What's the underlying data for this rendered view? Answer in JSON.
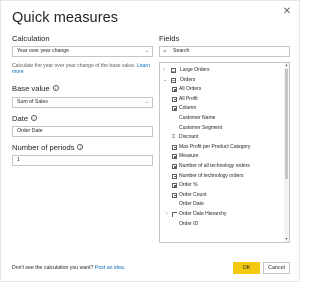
{
  "dialog": {
    "title": "Quick measures",
    "close_glyph": "✕"
  },
  "calculation": {
    "label": "Calculation",
    "selected": "Year over year change",
    "description_prefix": "Calculate the year over year change of the base value.",
    "learn_more": "Learn more"
  },
  "base_value": {
    "label": "Base value",
    "value": "Sum of Sales"
  },
  "date": {
    "label": "Date",
    "value": "Order Date"
  },
  "periods": {
    "label": "Number of periods",
    "value": "1"
  },
  "fields": {
    "label": "Fields",
    "search_placeholder": "Search",
    "items": [
      {
        "label": "Large Orders",
        "icon": "table-icon",
        "chevron": "›",
        "indent": 0
      },
      {
        "label": "Orders",
        "icon": "table-icon",
        "chevron": "⌄",
        "indent": 0
      },
      {
        "label": "All Orders",
        "icon": "calc-icon",
        "chevron": "",
        "indent": 1
      },
      {
        "label": "All Profit",
        "icon": "calc-icon",
        "chevron": "",
        "indent": 1
      },
      {
        "label": "Column",
        "icon": "calc-icon",
        "chevron": "",
        "indent": 1
      },
      {
        "label": "Customer Name",
        "icon": "",
        "chevron": "",
        "indent": 1
      },
      {
        "label": "Customer Segment",
        "icon": "",
        "chevron": "",
        "indent": 1
      },
      {
        "label": "Discount",
        "icon": "sigma-icon",
        "chevron": "",
        "indent": 1
      },
      {
        "label": "Max Profit per Product Category",
        "icon": "calc-icon",
        "chevron": "",
        "indent": 1
      },
      {
        "label": "Measure",
        "icon": "calc-icon",
        "chevron": "",
        "indent": 1
      },
      {
        "label": "Number of all technology orders",
        "icon": "calc-icon",
        "chevron": "",
        "indent": 1
      },
      {
        "label": "Number of technology orders",
        "icon": "calc-icon",
        "chevron": "",
        "indent": 1
      },
      {
        "label": "Order %",
        "icon": "calc-icon",
        "chevron": "",
        "indent": 1
      },
      {
        "label": "Order Count",
        "icon": "calc-icon",
        "chevron": "",
        "indent": 1
      },
      {
        "label": "Order Date",
        "icon": "",
        "chevron": "",
        "indent": 1
      },
      {
        "label": "Order Date Hierarchy",
        "icon": "hierarchy-icon",
        "chevron": "›",
        "indent": 1
      },
      {
        "label": "Order ID",
        "icon": "",
        "chevron": "",
        "indent": 1
      }
    ]
  },
  "footer": {
    "prompt": "Don't see the calculation you want?",
    "link": "Post an idea.",
    "ok_label": "OK",
    "cancel_label": "Cancel"
  },
  "colors": {
    "accent": "#f2c811",
    "link": "#0b6ab8",
    "border": "#c8c6c4"
  }
}
